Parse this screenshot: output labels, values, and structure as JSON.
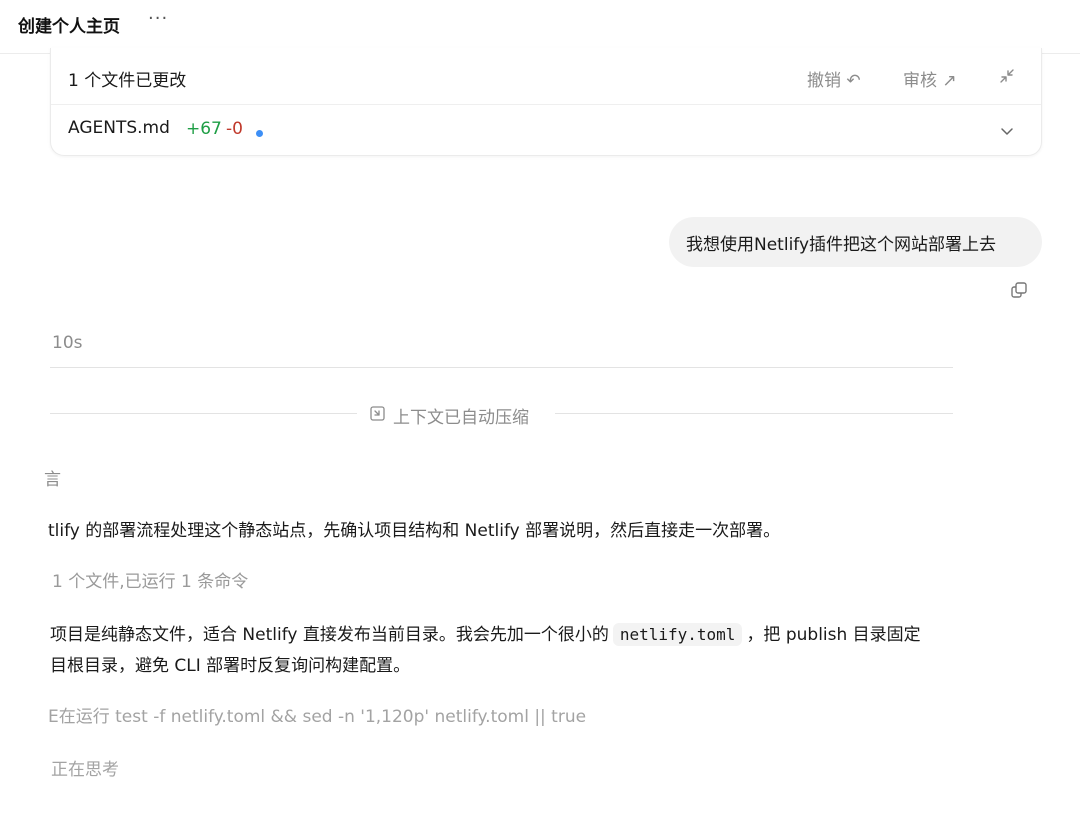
{
  "header": {
    "title": "创建个人主页",
    "more_label": "···"
  },
  "changes": {
    "summary": "1 个文件已更改",
    "undo_label": "撤销 ↶",
    "review_label": "审核 ↗",
    "file": {
      "name": "AGENTS.md",
      "additions": "+67",
      "deletions": "-0"
    }
  },
  "user_message": "我想使用Netlify插件把这个网站部署上去",
  "thread": {
    "duration": "10s",
    "compressed_label": "上下文已自动压缩",
    "partial_glyph": "言",
    "para1": "tlify 的部署流程处理这个静态站点，先确认项目结构和 Netlify 部署说明，然后直接走一次部署。",
    "status1": "1 个文件,已运行 1 条命令",
    "para2_prefix": "项目是纯静态文件，适合 Netlify 直接发布当前目录。我会先加一个很小的",
    "para2_code": "netlify.toml",
    "para2_suffix": "，把 publish 目录固定",
    "para2_line2": "目根目录，避免 CLI 部署时反复询问构建配置。",
    "running": "E在运行 test -f netlify.toml && sed -n '1,120p' netlify.toml || true",
    "thinking": "正在思考"
  },
  "icons": {
    "undo": "undo-icon",
    "review": "external-link-icon",
    "collapse": "collapse-icon",
    "expand": "chevron-down-icon",
    "copy": "copy-icon",
    "compress": "compress-icon"
  },
  "colors": {
    "additions": "#1e9e45",
    "deletions": "#c0392b",
    "dot": "#3d8ff6"
  }
}
